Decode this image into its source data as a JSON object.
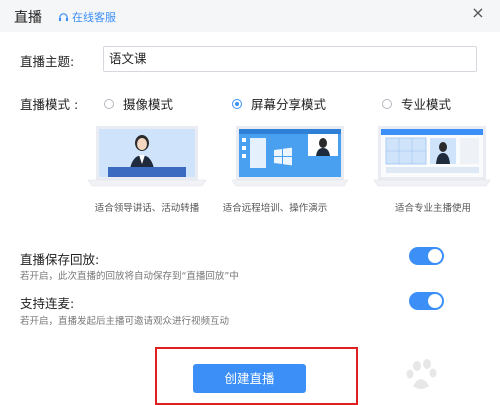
{
  "dialog": {
    "title": "直播",
    "service_label": "在线客服",
    "close_symbol": "×"
  },
  "topic": {
    "label": "直播主题:",
    "value": "语文课"
  },
  "mode": {
    "label": "直播模式 :",
    "options": [
      {
        "label": "摄像模式",
        "selected": false,
        "caption": "适合领导讲话、活动转播"
      },
      {
        "label": "屏幕分享模式",
        "selected": true,
        "caption": "适合远程培训、操作演示"
      },
      {
        "label": "专业模式",
        "selected": false,
        "caption": "适合专业主播使用"
      }
    ]
  },
  "save_replay": {
    "label": "直播保存回放:",
    "desc": "若开启，此次直播的回放将自动保存到“直播回放”中",
    "enabled": true
  },
  "co_host": {
    "label": "支持连麦:",
    "desc": "若开启，直播发起后主播可邀请观众进行视频互动",
    "enabled": true
  },
  "create_button": {
    "label": "创建直播"
  },
  "colors": {
    "accent": "#3b8ff6",
    "highlight_box": "#e02020",
    "header_bg": "#f5f6f8"
  },
  "icons": {
    "service": "headset-icon",
    "close": "close-icon",
    "watermark": "baidu-paw-icon"
  }
}
